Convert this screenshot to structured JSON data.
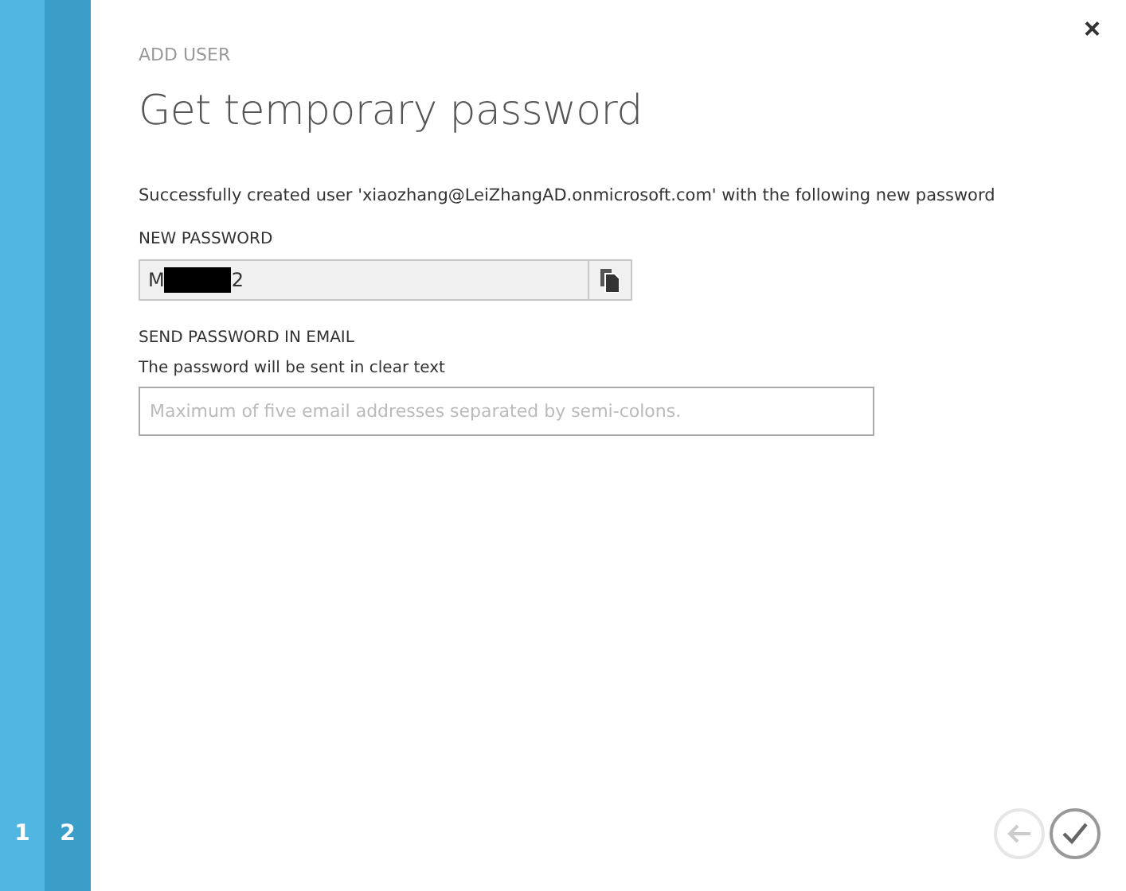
{
  "steps": [
    {
      "label": "1",
      "selected": false
    },
    {
      "label": "2",
      "selected": true
    }
  ],
  "close": "×",
  "subtitle": "ADD USER",
  "title": "Get temporary password",
  "message": "Successfully created user 'xiaozhang@LeiZhangAD.onmicrosoft.com' with the following new password",
  "new_password": {
    "label": "NEW PASSWORD",
    "value_start": "M",
    "value_end": "2",
    "redacted": true
  },
  "send_email": {
    "label": "SEND PASSWORD IN EMAIL",
    "hint": "The password will be sent in clear text",
    "placeholder": "Maximum of five email addresses separated by semi-colons."
  },
  "buttons": [
    {
      "kind": "back",
      "disabled": true
    },
    {
      "kind": "done",
      "disabled": false
    }
  ]
}
